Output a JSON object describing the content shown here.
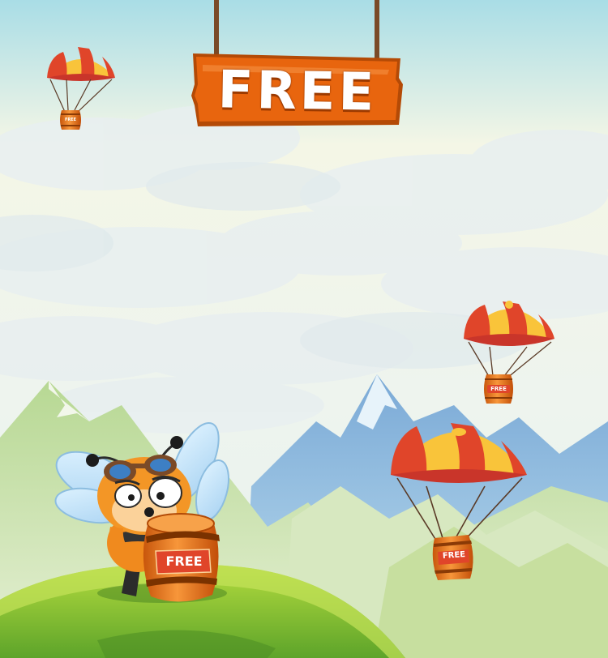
{
  "sign": {
    "text": "FREE"
  },
  "barrels": [
    {
      "id": "small-left",
      "label": "FREE"
    },
    {
      "id": "mid-right",
      "label": "FREE"
    },
    {
      "id": "large-right",
      "label": "FREE"
    },
    {
      "id": "bee-barrel",
      "label": "FREE"
    }
  ],
  "colors": {
    "sky_top": "#a9dde6",
    "sky_bottom": "#f4f7ea",
    "sign_orange": "#e8650e",
    "parachute_red": "#e0452a",
    "parachute_yellow": "#f9c43a",
    "grass": "#8cc63f",
    "mountain_blue": "#6b9fcf"
  },
  "scene": {
    "character": "bee-pilot",
    "icons": [
      "parachute-icon",
      "barrel-icon",
      "bee-icon",
      "sign-icon"
    ]
  }
}
